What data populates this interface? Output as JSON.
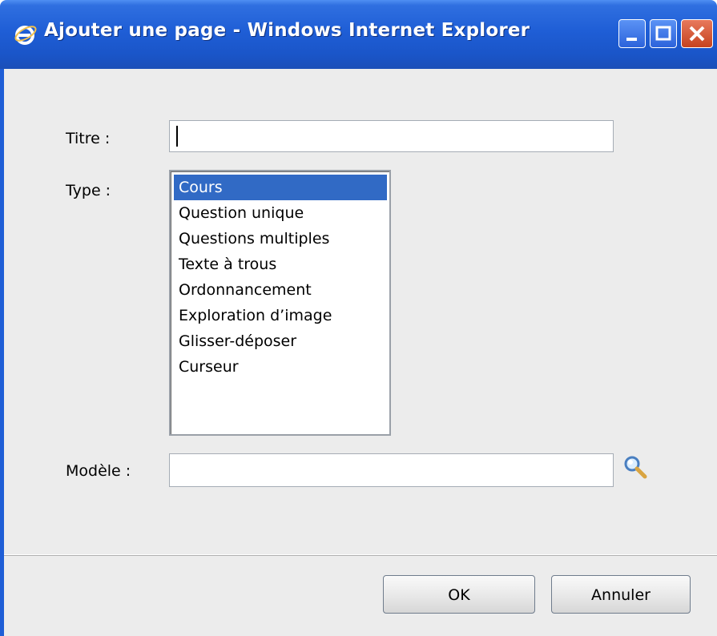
{
  "window": {
    "title": "Ajouter une page - Windows Internet Explorer",
    "colors": {
      "titlebar": "#1f5ed6",
      "selection": "#316ac5",
      "close": "#c6431f"
    }
  },
  "form": {
    "titre_label": "Titre :",
    "titre_value": "",
    "type_label": "Type :",
    "type_options": [
      "Cours",
      "Question unique",
      "Questions multiples",
      "Texte à trous",
      "Ordonnancement",
      "Exploration d’image",
      "Glisser-déposer",
      "Curseur"
    ],
    "type_selected": "Cours",
    "modele_label": "Modèle :",
    "modele_value": ""
  },
  "icons": {
    "app": "internet-explorer-icon",
    "lookup": "magnifier-icon"
  },
  "footer": {
    "ok_label": "OK",
    "cancel_label": "Annuler"
  }
}
